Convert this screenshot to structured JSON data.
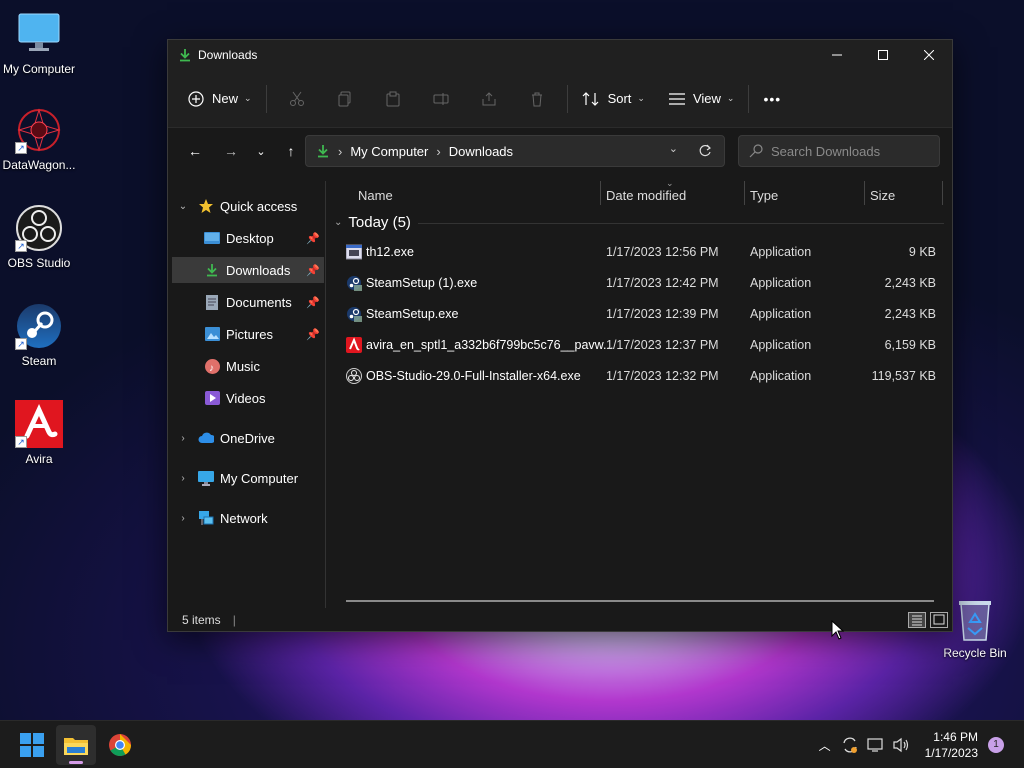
{
  "desktop": {
    "icons": [
      {
        "label": "My Computer"
      },
      {
        "label": "DataWagon..."
      },
      {
        "label": "OBS Studio"
      },
      {
        "label": "Steam"
      },
      {
        "label": "Avira"
      },
      {
        "label": "Recycle Bin"
      }
    ]
  },
  "window": {
    "title": "Downloads",
    "toolbar": {
      "new_label": "New",
      "sort_label": "Sort",
      "view_label": "View",
      "more_label": "•••"
    },
    "breadcrumb": [
      "My Computer",
      "Downloads"
    ],
    "search_placeholder": "Search Downloads",
    "nav": {
      "quick_access": "Quick access",
      "desktop": "Desktop",
      "downloads": "Downloads",
      "documents": "Documents",
      "pictures": "Pictures",
      "music": "Music",
      "videos": "Videos",
      "onedrive": "OneDrive",
      "my_computer": "My Computer",
      "network": "Network"
    },
    "columns": {
      "name": "Name",
      "date": "Date modified",
      "type": "Type",
      "size": "Size"
    },
    "group_label": "Today (5)",
    "files": [
      {
        "name": "th12.exe",
        "date": "1/17/2023 12:56 PM",
        "type": "Application",
        "size": "9 KB"
      },
      {
        "name": "SteamSetup (1).exe",
        "date": "1/17/2023 12:42 PM",
        "type": "Application",
        "size": "2,243 KB"
      },
      {
        "name": "SteamSetup.exe",
        "date": "1/17/2023 12:39 PM",
        "type": "Application",
        "size": "2,243 KB"
      },
      {
        "name": "avira_en_sptl1_a332b6f799bc5c76__pavw...",
        "date": "1/17/2023 12:37 PM",
        "type": "Application",
        "size": "6,159 KB"
      },
      {
        "name": "OBS-Studio-29.0-Full-Installer-x64.exe",
        "date": "1/17/2023 12:32 PM",
        "type": "Application",
        "size": "119,537 KB"
      }
    ],
    "status": "5 items"
  },
  "taskbar": {
    "time": "1:46 PM",
    "date": "1/17/2023",
    "notification_count": "1"
  },
  "colors": {
    "accent_green": "#3fb950",
    "selection": "#3a3a3a",
    "window_bg": "#191919"
  }
}
